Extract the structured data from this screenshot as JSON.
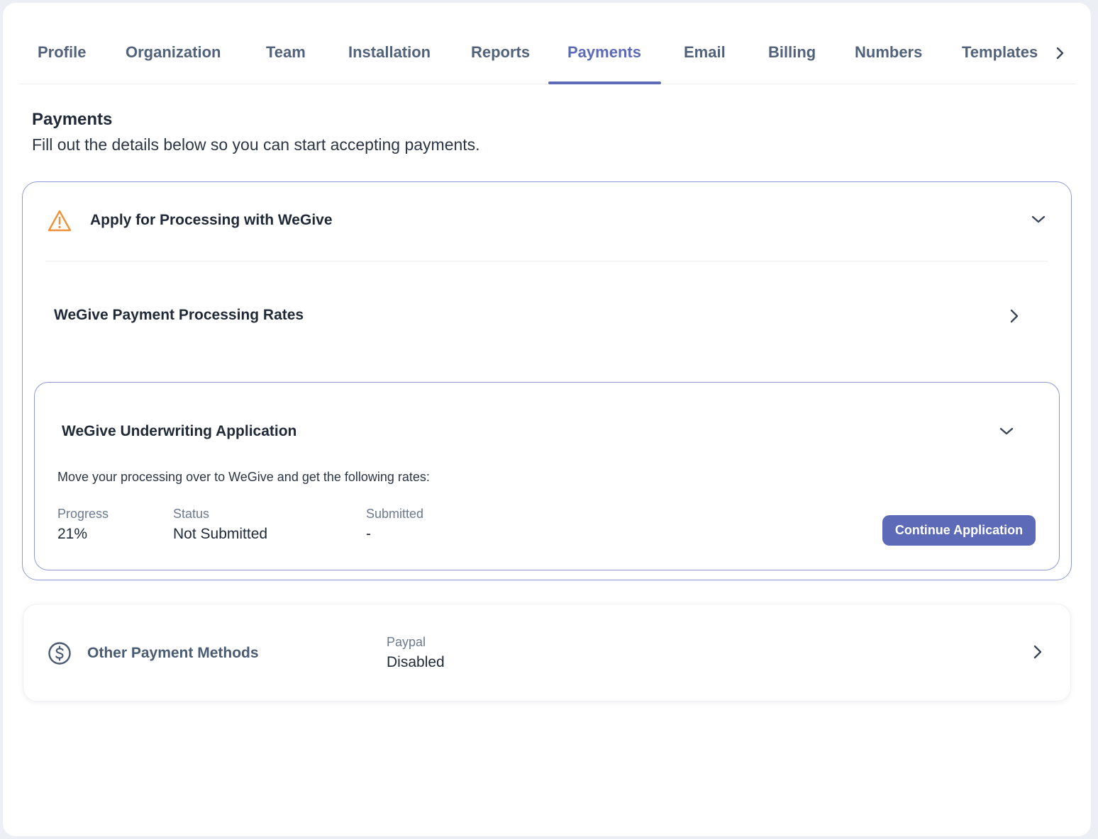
{
  "tabs": {
    "items": [
      "Profile",
      "Organization",
      "Team",
      "Installation",
      "Reports",
      "Payments",
      "Email",
      "Billing",
      "Numbers",
      "Templates"
    ],
    "active": "Payments"
  },
  "header": {
    "title": "Payments",
    "subtitle": "Fill out the details below so you can start accepting payments."
  },
  "apply_card": {
    "title": "Apply for Processing with WeGive",
    "icon": "warning-icon",
    "warning_color": "#f0913a",
    "rates_row": {
      "title": "WeGive Payment Processing Rates"
    },
    "underwriting": {
      "title": "WeGive Underwriting Application",
      "description": "Move your processing over to WeGive and get the following rates:",
      "progress_label": "Progress",
      "progress_value": "21%",
      "status_label": "Status",
      "status_value": "Not Submitted",
      "submitted_label": "Submitted",
      "submitted_value": "-",
      "continue_button": "Continue Application"
    }
  },
  "other_methods": {
    "title": "Other Payment Methods",
    "icon": "dollar-circle-icon",
    "paypal_label": "Paypal",
    "paypal_value": "Disabled"
  },
  "colors": {
    "accent": "#5d6ab8",
    "border_accent": "#8f98d6",
    "text_muted": "#6b7a90"
  }
}
